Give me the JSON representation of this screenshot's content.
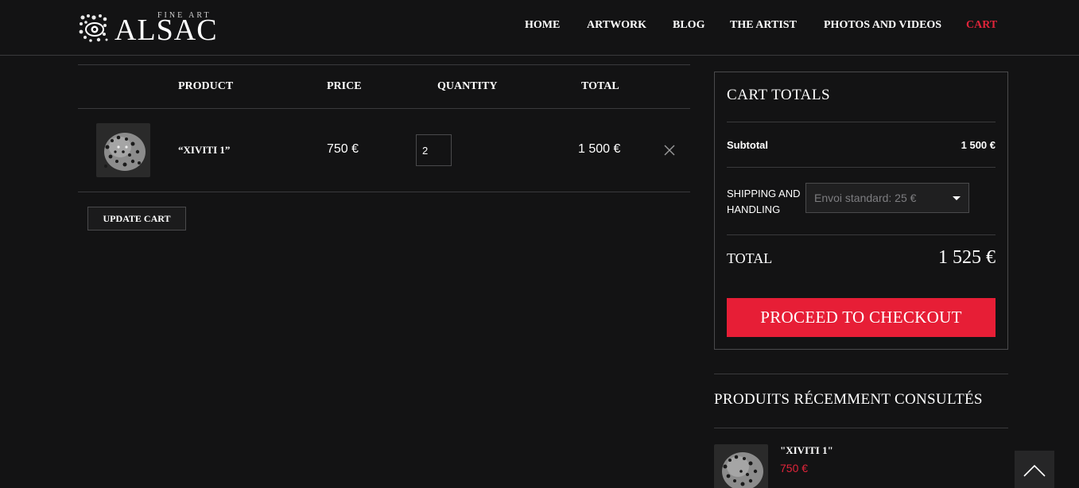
{
  "brand": {
    "name": "ALSAC",
    "tagline": "FINE ART"
  },
  "nav": {
    "items": [
      {
        "label": "HOME"
      },
      {
        "label": "ARTWORK"
      },
      {
        "label": "BLOG"
      },
      {
        "label": "THE ARTIST"
      },
      {
        "label": "PHOTOS AND VIDEOS"
      },
      {
        "label": "CART"
      }
    ],
    "active": "CART"
  },
  "cart_table": {
    "headers": {
      "product": "PRODUCT",
      "price": "PRICE",
      "quantity": "QUANTITY",
      "total": "TOTAL"
    },
    "rows": [
      {
        "product": "“XIVITI 1”",
        "price": "750 €",
        "quantity": "2",
        "total": "1 500 €",
        "thumb_icon": "leopard-photo-thumbnail"
      }
    ],
    "update_label": "UPDATE CART"
  },
  "totals": {
    "title": "CART TOTALS",
    "subtotal_label": "Subtotal",
    "subtotal_value": "1 500 €",
    "shipping_label": "SHIPPING AND HANDLING",
    "shipping_selected": "Envoi standard: 25 €",
    "total_label": "TOTAL",
    "total_value": "1 525 €",
    "checkout_label": "PROCEED TO CHECKOUT"
  },
  "recently_viewed": {
    "title": "PRODUITS RÉCEMMENT CONSULTÉS",
    "items": [
      {
        "name": "\"XIVITI 1\"",
        "price": "750 €"
      }
    ]
  },
  "colors": {
    "background": "#131314",
    "accent": "#e71e36",
    "border": "#3a3a3c"
  }
}
